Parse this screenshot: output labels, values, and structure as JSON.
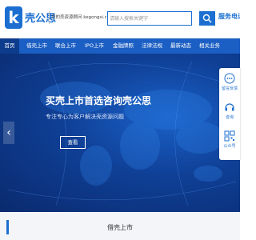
{
  "header": {
    "logo_letter": "k",
    "logo_text": "壳公思",
    "slogan": "您的壳资源顾问 kegongsi.com",
    "search_placeholder": "请输入搜索关键字",
    "hotline": "服务电话："
  },
  "nav": {
    "items": [
      "首页",
      "借壳上市",
      "联合上市",
      "IPO上市",
      "金融牌照",
      "法律法规",
      "最新动态",
      "相关业务"
    ]
  },
  "hero": {
    "title": "买壳上市首选咨询壳公思",
    "subtitle": "专注专心为客户解决壳资源问题",
    "button": "查看",
    "arrow_left": "‹",
    "arrow_right": "›"
  },
  "float": {
    "items": [
      "留言反馈",
      "咨询",
      "公众号"
    ]
  },
  "section": {
    "title": "借壳上市"
  },
  "colors": {
    "brand": "#1c6fd1",
    "nav": "#1c5fc4",
    "nav_active": "#0d3c8d"
  }
}
